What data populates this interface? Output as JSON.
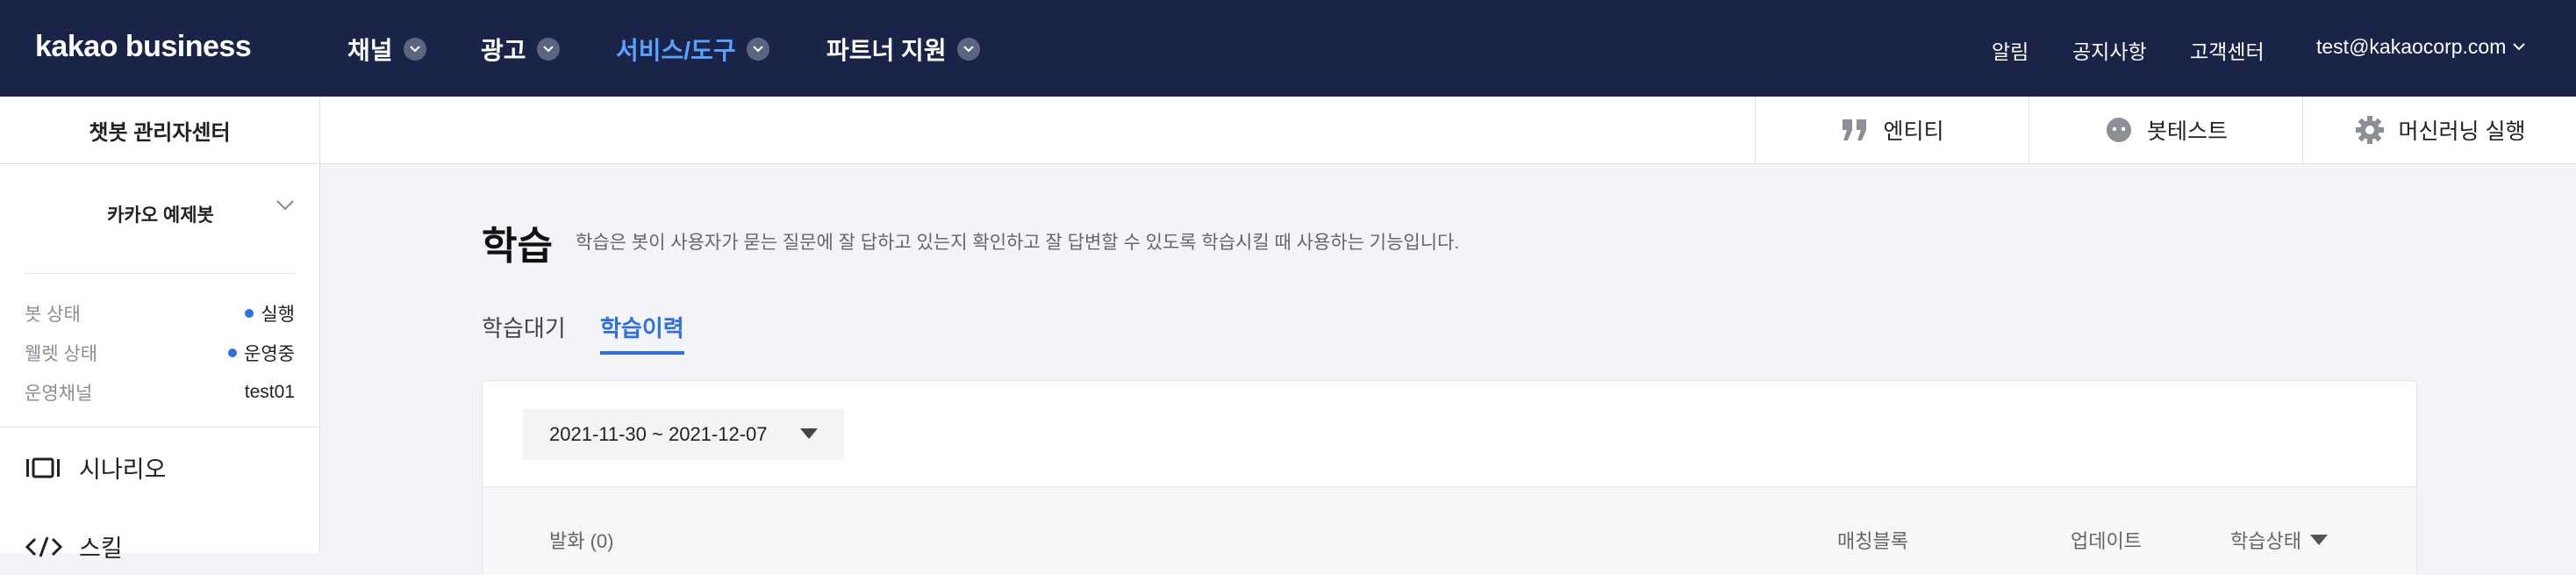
{
  "topnav": {
    "logo": "kakao business",
    "items": [
      {
        "label": "채널",
        "active": false
      },
      {
        "label": "광고",
        "active": false
      },
      {
        "label": "서비스/도구",
        "active": true
      },
      {
        "label": "파트너 지원",
        "active": false
      }
    ],
    "right": {
      "alert": "알림",
      "notice": "공지사항",
      "support": "고객센터",
      "account": "test@kakaocorp.com"
    }
  },
  "subbar": {
    "title": "챗봇 관리자센터",
    "tools": [
      {
        "label": "엔티티",
        "icon": "quote-icon"
      },
      {
        "label": "봇테스트",
        "icon": "chat-bubble-icon"
      },
      {
        "label": "머신러닝 실행",
        "icon": "gear-icon"
      }
    ]
  },
  "sidebar": {
    "bot_name": "카카오 예제봇",
    "info": [
      {
        "key": "봇 상태",
        "value": "실행",
        "dot": true
      },
      {
        "key": "웰렛 상태",
        "value": "운영중",
        "dot": true
      },
      {
        "key": "운영채널",
        "value": "test01",
        "dot": false
      }
    ],
    "menu": [
      {
        "label": "시나리오",
        "icon": "scenario-icon"
      },
      {
        "label": "스킬",
        "icon": "code-icon"
      }
    ]
  },
  "main": {
    "title": "학습",
    "description": "학습은 봇이 사용자가 묻는 질문에 잘 답하고 있는지 확인하고 잘 답변할 수 있도록 학습시킬 때 사용하는 기능입니다.",
    "tabs": [
      {
        "label": "학습대기",
        "active": false
      },
      {
        "label": "학습이력",
        "active": true
      }
    ],
    "date_range": "2021-11-30 ~ 2021-12-07",
    "columns": {
      "utterance": "발화 (0)",
      "matched_block": "매칭블록",
      "update": "업데이트",
      "status": "학습상태"
    }
  },
  "colors": {
    "nav_bg": "#1a2449",
    "accent": "#2f6fe4",
    "nav_active": "#5aa0ff"
  }
}
